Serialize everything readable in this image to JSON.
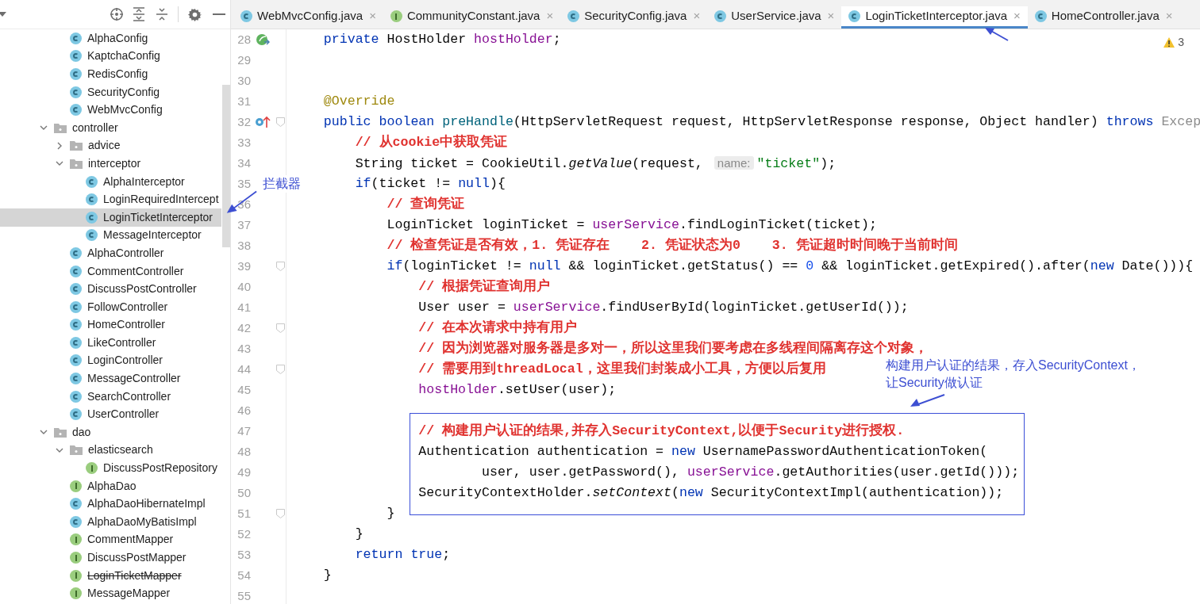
{
  "project_tree": [
    {
      "children": [
        {
          "kind": "class",
          "label": "AlphaConfig",
          "selected": false,
          "deprecated": false
        },
        {
          "kind": "class",
          "label": "KaptchaConfig",
          "selected": false,
          "deprecated": false
        },
        {
          "kind": "class",
          "label": "RedisConfig",
          "selected": false,
          "deprecated": false
        },
        {
          "kind": "class",
          "label": "SecurityConfig",
          "selected": false,
          "deprecated": false
        },
        {
          "kind": "class",
          "label": "WebMvcConfig",
          "selected": false,
          "deprecated": false
        }
      ]
    },
    {
      "kind": "folder",
      "label": "controller",
      "expanded": true,
      "selected": false,
      "deprecated": false,
      "children": [
        {
          "kind": "folder",
          "label": "advice",
          "expanded": false,
          "selected": false,
          "deprecated": false
        },
        {
          "kind": "folder",
          "label": "interceptor",
          "expanded": true,
          "selected": false,
          "deprecated": false,
          "children": [
            {
              "kind": "class",
              "label": "AlphaInterceptor",
              "selected": false,
              "deprecated": false
            },
            {
              "kind": "class",
              "label": "LoginRequiredIntercept",
              "selected": false,
              "deprecated": false
            },
            {
              "kind": "class",
              "label": "LoginTicketInterceptor",
              "selected": true,
              "deprecated": false
            },
            {
              "kind": "class",
              "label": "MessageInterceptor",
              "selected": false,
              "deprecated": false
            }
          ]
        },
        {
          "kind": "class",
          "label": "AlphaController",
          "selected": false,
          "deprecated": false
        },
        {
          "kind": "class",
          "label": "CommentController",
          "selected": false,
          "deprecated": false
        },
        {
          "kind": "class",
          "label": "DiscussPostController",
          "selected": false,
          "deprecated": false
        },
        {
          "kind": "class",
          "label": "FollowController",
          "selected": false,
          "deprecated": false
        },
        {
          "kind": "class",
          "label": "HomeController",
          "selected": false,
          "deprecated": false
        },
        {
          "kind": "class",
          "label": "LikeController",
          "selected": false,
          "deprecated": false
        },
        {
          "kind": "class",
          "label": "LoginController",
          "selected": false,
          "deprecated": false
        },
        {
          "kind": "class",
          "label": "MessageController",
          "selected": false,
          "deprecated": false
        },
        {
          "kind": "class",
          "label": "SearchController",
          "selected": false,
          "deprecated": false
        },
        {
          "kind": "class",
          "label": "UserController",
          "selected": false,
          "deprecated": false
        }
      ]
    },
    {
      "kind": "folder",
      "label": "dao",
      "expanded": true,
      "selected": false,
      "deprecated": false,
      "children": [
        {
          "kind": "folder",
          "label": "elasticsearch",
          "expanded": true,
          "selected": false,
          "deprecated": false,
          "children": [
            {
              "kind": "interface",
              "label": "DiscussPostRepository",
              "selected": false,
              "deprecated": false
            }
          ]
        },
        {
          "kind": "interface",
          "label": "AlphaDao",
          "selected": false,
          "deprecated": false
        },
        {
          "kind": "class",
          "label": "AlphaDaoHibernateImpl",
          "selected": false,
          "deprecated": false
        },
        {
          "kind": "class",
          "label": "AlphaDaoMyBatisImpl",
          "selected": false,
          "deprecated": false
        },
        {
          "kind": "interface",
          "label": "CommentMapper",
          "selected": false,
          "deprecated": false
        },
        {
          "kind": "interface",
          "label": "DiscussPostMapper",
          "selected": false,
          "deprecated": false
        },
        {
          "kind": "interface",
          "label": "LoginTicketMapper",
          "selected": false,
          "deprecated": true
        },
        {
          "kind": "interface",
          "label": "MessageMapper",
          "selected": false,
          "deprecated": false
        }
      ]
    }
  ],
  "tabs": [
    {
      "kind": "class",
      "label": "WebMvcConfig.java",
      "close": "×",
      "selected": false
    },
    {
      "kind": "interface",
      "label": "CommunityConstant.java",
      "close": "×",
      "selected": false
    },
    {
      "kind": "class",
      "label": "SecurityConfig.java",
      "close": "×",
      "selected": false
    },
    {
      "kind": "class",
      "label": "UserService.java",
      "close": "×",
      "selected": false
    },
    {
      "kind": "class",
      "label": "LoginTicketInterceptor.java",
      "close": "×",
      "selected": true
    },
    {
      "kind": "class",
      "label": "HomeController.java",
      "close": "×",
      "selected": false
    }
  ],
  "inspection": {
    "warnings": "3"
  },
  "code_lines": [
    {
      "number": "28",
      "gutter": {
        "kind": "bean"
      },
      "fold": false,
      "tokens": [
        {
          "kind": "keyword",
          "text": "    private"
        },
        {
          "kind": "plain",
          "text": " HostHolder "
        },
        {
          "kind": "field",
          "text": "hostHolder"
        },
        {
          "kind": "plain",
          "text": ";"
        }
      ]
    },
    {
      "number": "29",
      "fold": false
    },
    {
      "number": "30",
      "fold": false
    },
    {
      "number": "31",
      "fold": false,
      "tokens": [
        {
          "kind": "annotation",
          "text": "    @Override"
        }
      ]
    },
    {
      "number": "32",
      "gutter": {
        "kind": "override"
      },
      "fold": true,
      "tokens": [
        {
          "kind": "keyword",
          "text": "    public "
        },
        {
          "kind": "keyword",
          "text": "boolean "
        },
        {
          "kind": "declaration",
          "text": "preHandle"
        },
        {
          "kind": "plain",
          "text": "(HttpServletRequest request, HttpServletResponse response, Object handler) "
        },
        {
          "kind": "keyword",
          "text": "throws "
        },
        {
          "kind": "muted",
          "text": "Excep"
        }
      ]
    },
    {
      "number": "33",
      "fold": false,
      "tokens": [
        {
          "kind": "comment",
          "text": "        // 从cookie中获取凭证"
        }
      ]
    },
    {
      "number": "34",
      "fold": false,
      "tokens": [
        {
          "kind": "plain",
          "text": "        String ticket = CookieUtil."
        },
        {
          "kind": "static",
          "text": "getValue"
        },
        {
          "kind": "plain",
          "text": "(request, "
        },
        {
          "kind": "hint",
          "text": "name:"
        },
        {
          "kind": "string",
          "text": "\"ticket\""
        },
        {
          "kind": "plain",
          "text": ");"
        }
      ]
    },
    {
      "number": "35",
      "fold": false,
      "tokens": [
        {
          "kind": "keyword",
          "text": "        if"
        },
        {
          "kind": "plain",
          "text": "(ticket != "
        },
        {
          "kind": "keyword",
          "text": "null"
        },
        {
          "kind": "plain",
          "text": "){"
        }
      ]
    },
    {
      "number": "36",
      "fold": false,
      "tokens": [
        {
          "kind": "comment",
          "text": "            // 查询凭证"
        }
      ]
    },
    {
      "number": "37",
      "fold": false,
      "tokens": [
        {
          "kind": "plain",
          "text": "            LoginTicket loginTicket = "
        },
        {
          "kind": "field",
          "text": "userService"
        },
        {
          "kind": "plain",
          "text": ".findLoginTicket(ticket);"
        }
      ]
    },
    {
      "number": "38",
      "fold": false,
      "tokens": [
        {
          "kind": "comment",
          "text": "            // 检查凭证是否有效，1. 凭证存在    2. 凭证状态为0    3. 凭证超时时间晚于当前时间"
        }
      ]
    },
    {
      "number": "39",
      "fold": true,
      "tokens": [
        {
          "kind": "keyword",
          "text": "            if"
        },
        {
          "kind": "plain",
          "text": "(loginTicket != "
        },
        {
          "kind": "keyword",
          "text": "null"
        },
        {
          "kind": "plain",
          "text": " && loginTicket.getStatus() == "
        },
        {
          "kind": "number",
          "text": "0"
        },
        {
          "kind": "plain",
          "text": " && loginTicket.getExpired().after("
        },
        {
          "kind": "keyword",
          "text": "new"
        },
        {
          "kind": "plain",
          "text": " Date())){"
        }
      ]
    },
    {
      "number": "40",
      "fold": false,
      "tokens": [
        {
          "kind": "comment",
          "text": "                // 根据凭证查询用户"
        }
      ]
    },
    {
      "number": "41",
      "fold": false,
      "tokens": [
        {
          "kind": "plain",
          "text": "                User user = "
        },
        {
          "kind": "field",
          "text": "userService"
        },
        {
          "kind": "plain",
          "text": ".findUserById(loginTicket.getUserId());"
        }
      ]
    },
    {
      "number": "42",
      "fold": true,
      "tokens": [
        {
          "kind": "comment",
          "text": "                // 在本次请求中持有用户"
        }
      ]
    },
    {
      "number": "43",
      "fold": false,
      "tokens": [
        {
          "kind": "comment",
          "text": "                // 因为浏览器对服务器是多对一，所以这里我们要考虑在多线程间隔离存这个对象，"
        }
      ]
    },
    {
      "number": "44",
      "fold": true,
      "tokens": [
        {
          "kind": "comment",
          "text": "                // 需要用到threadLocal，这里我们封装成小工具，方便以后复用"
        }
      ]
    },
    {
      "number": "45",
      "fold": false,
      "tokens": [
        {
          "kind": "field",
          "text": "                hostHolder"
        },
        {
          "kind": "plain",
          "text": ".setUser(user);"
        }
      ]
    },
    {
      "number": "46",
      "fold": false
    },
    {
      "number": "47",
      "fold": false,
      "tokens": [
        {
          "kind": "comment",
          "text": "                // 构建用户认证的结果,并存入SecurityContext,以便于Security进行授权."
        }
      ]
    },
    {
      "number": "48",
      "fold": false,
      "tokens": [
        {
          "kind": "plain",
          "text": "                Authentication authentication = "
        },
        {
          "kind": "keyword",
          "text": "new"
        },
        {
          "kind": "plain",
          "text": " UsernamePasswordAuthenticationToken("
        }
      ]
    },
    {
      "number": "49",
      "fold": false,
      "tokens": [
        {
          "kind": "plain",
          "text": "                        user, user.getPassword(), "
        },
        {
          "kind": "field",
          "text": "userService"
        },
        {
          "kind": "plain",
          "text": ".getAuthorities(user.getId()));"
        }
      ]
    },
    {
      "number": "50",
      "fold": false,
      "tokens": [
        {
          "kind": "plain",
          "text": "                SecurityContextHolder."
        },
        {
          "kind": "static",
          "text": "setContext"
        },
        {
          "kind": "plain",
          "text": "("
        },
        {
          "kind": "keyword",
          "text": "new"
        },
        {
          "kind": "plain",
          "text": " SecurityContextImpl(authentication));"
        }
      ]
    },
    {
      "number": "51",
      "fold": true,
      "tokens": [
        {
          "kind": "plain",
          "text": "            }"
        }
      ]
    },
    {
      "number": "52",
      "fold": false,
      "tokens": [
        {
          "kind": "plain",
          "text": "        }"
        }
      ]
    },
    {
      "number": "53",
      "fold": false,
      "tokens": [
        {
          "kind": "keyword",
          "text": "        return "
        },
        {
          "kind": "keyword",
          "text": "true"
        },
        {
          "kind": "plain",
          "text": ";"
        }
      ]
    },
    {
      "number": "54",
      "fold": false,
      "tokens": [
        {
          "kind": "plain",
          "text": "    }"
        }
      ]
    },
    {
      "number": "55",
      "fold": false
    }
  ],
  "annotations": [
    {
      "lines": [
        "拦截器"
      ]
    },
    {
      "lines": [
        "构建用户认证的结果，存入SecurityContext，",
        "让Security做认证"
      ]
    }
  ]
}
